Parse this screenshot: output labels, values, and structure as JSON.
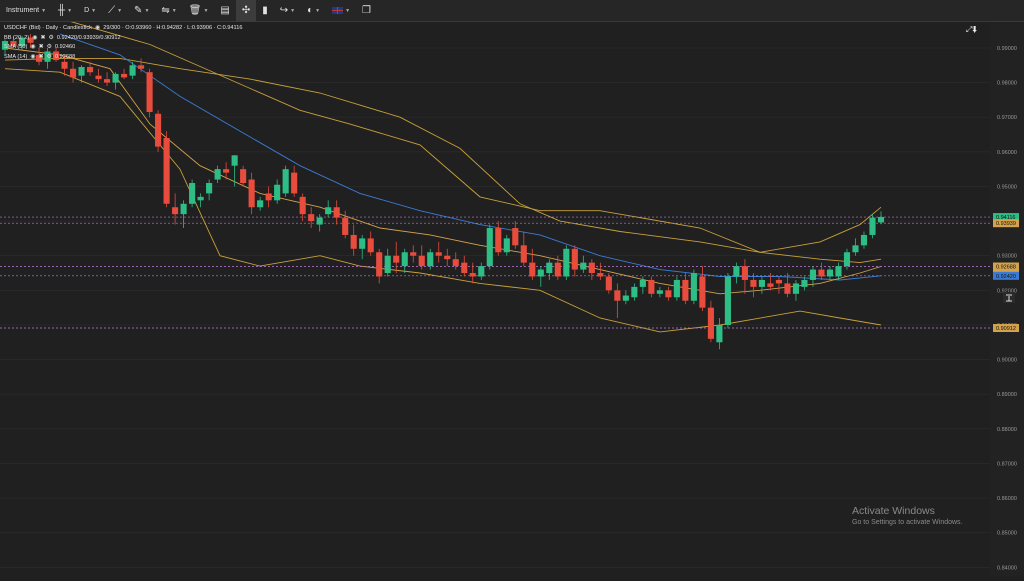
{
  "toolbar": {
    "instrument_label": "Instrument",
    "timeframe_label": "D",
    "icons": [
      "candle-type-icon",
      "line-tool-icon",
      "pen-tool-icon",
      "indicator-tool-icon",
      "trash-icon",
      "layout-icon",
      "crosshair-icon",
      "bar-icon",
      "share-icon",
      "theme-icon",
      "language-flag-icon",
      "new-window-icon"
    ]
  },
  "legend": {
    "main": "USDCHF (Bid) · Daily · Candlestick",
    "ohlc": "29/300 · O:0.93960 · H:0.94282 · L:0.93906 · C:0.94116",
    "indicators": [
      {
        "name": "BB (20, 2)",
        "value": "0.92420/0.93939/0.90912"
      },
      {
        "name": "SMA (50)",
        "value": "0.92460"
      },
      {
        "name": "SMA (14)",
        "value": "0.92688"
      }
    ]
  },
  "watermark": {
    "title": "Activate Windows",
    "subtitle": "Go to Settings to activate Windows."
  },
  "colors": {
    "up": "#2ebd85",
    "down": "#e74c3c",
    "bb": "#c9a03a",
    "sma50": "#3b7bd4",
    "sma14": "#d4a24c",
    "grid": "#2c2c2c",
    "marker": "#c07ae0"
  },
  "chart_data": {
    "type": "candlestick",
    "title": "USDCHF (Bid) · Daily · Candlestick",
    "y_axis_ticks": [
      "0.99000",
      "0.98000",
      "0.97000",
      "0.96000",
      "0.95000",
      "0.94000",
      "0.93000",
      "0.92000",
      "0.91000",
      "0.90000",
      "0.89000",
      "0.88000",
      "0.87000",
      "0.86000",
      "0.85000",
      "0.84000"
    ],
    "ylim": [
      0.8375,
      0.9975
    ],
    "price_tags": [
      {
        "label": "0.94116",
        "value": 0.94116,
        "color": "#2ebd85"
      },
      {
        "label": "0.93939",
        "value": 0.93939,
        "color": "#d4a24c"
      },
      {
        "label": "0.92688",
        "value": 0.92688,
        "color": "#d4a24c"
      },
      {
        "label": "0.92460",
        "value": 0.9246,
        "color": "#d4a24c"
      },
      {
        "label": "0.92420",
        "value": 0.9242,
        "color": "#3b7bd4"
      },
      {
        "label": "0.90912",
        "value": 0.90912,
        "color": "#d4a24c"
      }
    ],
    "candles": [
      [
        0.9895,
        0.9925,
        0.988,
        0.992
      ],
      [
        0.992,
        0.9935,
        0.99,
        0.9905
      ],
      [
        0.9905,
        0.9935,
        0.9895,
        0.993
      ],
      [
        0.993,
        0.994,
        0.99,
        0.9915
      ],
      [
        0.988,
        0.99,
        0.985,
        0.986
      ],
      [
        0.986,
        0.99,
        0.984,
        0.989
      ],
      [
        0.989,
        0.99,
        0.986,
        0.9865
      ],
      [
        0.986,
        0.988,
        0.982,
        0.984
      ],
      [
        0.984,
        0.986,
        0.98,
        0.9815
      ],
      [
        0.982,
        0.985,
        0.98,
        0.9845
      ],
      [
        0.9845,
        0.986,
        0.982,
        0.983
      ],
      [
        0.982,
        0.984,
        0.98,
        0.981
      ],
      [
        0.981,
        0.983,
        0.979,
        0.98
      ],
      [
        0.98,
        0.983,
        0.978,
        0.9825
      ],
      [
        0.9825,
        0.984,
        0.981,
        0.9815
      ],
      [
        0.982,
        0.986,
        0.981,
        0.985
      ],
      [
        0.985,
        0.987,
        0.983,
        0.984
      ],
      [
        0.983,
        0.984,
        0.97,
        0.9715
      ],
      [
        0.971,
        0.972,
        0.96,
        0.9615
      ],
      [
        0.964,
        0.966,
        0.944,
        0.945
      ],
      [
        0.944,
        0.948,
        0.939,
        0.942
      ],
      [
        0.942,
        0.946,
        0.938,
        0.945
      ],
      [
        0.945,
        0.952,
        0.944,
        0.951
      ],
      [
        0.946,
        0.948,
        0.944,
        0.947
      ],
      [
        0.948,
        0.952,
        0.946,
        0.951
      ],
      [
        0.952,
        0.956,
        0.951,
        0.955
      ],
      [
        0.955,
        0.957,
        0.952,
        0.954
      ],
      [
        0.956,
        0.959,
        0.95,
        0.959
      ],
      [
        0.955,
        0.956,
        0.95,
        0.951
      ],
      [
        0.952,
        0.954,
        0.942,
        0.944
      ],
      [
        0.944,
        0.947,
        0.943,
        0.946
      ],
      [
        0.948,
        0.95,
        0.944,
        0.946
      ],
      [
        0.946,
        0.952,
        0.945,
        0.9505
      ],
      [
        0.948,
        0.956,
        0.947,
        0.955
      ],
      [
        0.954,
        0.956,
        0.947,
        0.948
      ],
      [
        0.947,
        0.948,
        0.94,
        0.942
      ],
      [
        0.942,
        0.944,
        0.938,
        0.94
      ],
      [
        0.939,
        0.942,
        0.937,
        0.941
      ],
      [
        0.942,
        0.946,
        0.941,
        0.944
      ],
      [
        0.944,
        0.946,
        0.939,
        0.941
      ],
      [
        0.941,
        0.943,
        0.935,
        0.936
      ],
      [
        0.936,
        0.939,
        0.93,
        0.932
      ],
      [
        0.932,
        0.936,
        0.929,
        0.935
      ],
      [
        0.935,
        0.937,
        0.93,
        0.931
      ],
      [
        0.931,
        0.932,
        0.922,
        0.924
      ],
      [
        0.925,
        0.932,
        0.924,
        0.93
      ],
      [
        0.93,
        0.934,
        0.925,
        0.928
      ],
      [
        0.927,
        0.932,
        0.925,
        0.931
      ],
      [
        0.931,
        0.933,
        0.928,
        0.93
      ],
      [
        0.93,
        0.933,
        0.926,
        0.927
      ],
      [
        0.927,
        0.932,
        0.926,
        0.931
      ],
      [
        0.931,
        0.934,
        0.928,
        0.93
      ],
      [
        0.93,
        0.932,
        0.927,
        0.929
      ],
      [
        0.929,
        0.931,
        0.926,
        0.927
      ],
      [
        0.928,
        0.93,
        0.924,
        0.925
      ],
      [
        0.925,
        0.928,
        0.922,
        0.924
      ],
      [
        0.924,
        0.928,
        0.923,
        0.927
      ],
      [
        0.927,
        0.939,
        0.926,
        0.938
      ],
      [
        0.938,
        0.94,
        0.93,
        0.931
      ],
      [
        0.931,
        0.936,
        0.93,
        0.935
      ],
      [
        0.938,
        0.94,
        0.932,
        0.933
      ],
      [
        0.933,
        0.937,
        0.927,
        0.928
      ],
      [
        0.928,
        0.932,
        0.923,
        0.924
      ],
      [
        0.924,
        0.927,
        0.921,
        0.926
      ],
      [
        0.925,
        0.929,
        0.923,
        0.928
      ],
      [
        0.928,
        0.93,
        0.923,
        0.924
      ],
      [
        0.924,
        0.933,
        0.923,
        0.932
      ],
      [
        0.932,
        0.933,
        0.924,
        0.926
      ],
      [
        0.926,
        0.93,
        0.925,
        0.928
      ],
      [
        0.928,
        0.929,
        0.923,
        0.925
      ],
      [
        0.925,
        0.928,
        0.923,
        0.924
      ],
      [
        0.924,
        0.925,
        0.919,
        0.92
      ],
      [
        0.92,
        0.922,
        0.912,
        0.917
      ],
      [
        0.917,
        0.92,
        0.916,
        0.9185
      ],
      [
        0.918,
        0.922,
        0.917,
        0.921
      ],
      [
        0.921,
        0.924,
        0.919,
        0.923
      ],
      [
        0.923,
        0.924,
        0.918,
        0.919
      ],
      [
        0.919,
        0.921,
        0.918,
        0.92
      ],
      [
        0.92,
        0.921,
        0.917,
        0.918
      ],
      [
        0.918,
        0.924,
        0.917,
        0.923
      ],
      [
        0.923,
        0.925,
        0.916,
        0.917
      ],
      [
        0.917,
        0.926,
        0.916,
        0.925
      ],
      [
        0.924,
        0.927,
        0.914,
        0.915
      ],
      [
        0.915,
        0.917,
        0.905,
        0.906
      ],
      [
        0.905,
        0.912,
        0.903,
        0.91
      ],
      [
        0.91,
        0.925,
        0.909,
        0.924
      ],
      [
        0.924,
        0.928,
        0.922,
        0.927
      ],
      [
        0.927,
        0.929,
        0.919,
        0.923
      ],
      [
        0.923,
        0.925,
        0.918,
        0.921
      ],
      [
        0.921,
        0.924,
        0.919,
        0.923
      ],
      [
        0.922,
        0.925,
        0.92,
        0.921
      ],
      [
        0.923,
        0.924,
        0.919,
        0.922
      ],
      [
        0.922,
        0.925,
        0.918,
        0.919
      ],
      [
        0.919,
        0.923,
        0.917,
        0.922
      ],
      [
        0.921,
        0.924,
        0.92,
        0.923
      ],
      [
        0.923,
        0.927,
        0.921,
        0.926
      ],
      [
        0.926,
        0.928,
        0.923,
        0.924
      ],
      [
        0.924,
        0.927,
        0.923,
        0.926
      ],
      [
        0.924,
        0.928,
        0.923,
        0.927
      ],
      [
        0.927,
        0.932,
        0.926,
        0.931
      ],
      [
        0.931,
        0.935,
        0.93,
        0.933
      ],
      [
        0.933,
        0.937,
        0.932,
        0.936
      ],
      [
        0.936,
        0.942,
        0.935,
        0.941
      ],
      [
        0.9396,
        0.9428,
        0.9391,
        0.9412
      ]
    ],
    "candle_x_range": [
      5,
      881
    ],
    "overlays": [
      {
        "name": "BB (20, 2) upper",
        "color": "#c9a03a",
        "points": [
          [
            5,
            0.9985
          ],
          [
            60,
            0.9985
          ],
          [
            150,
            0.991
          ],
          [
            300,
            0.972
          ],
          [
            350,
            0.968
          ],
          [
            420,
            0.962
          ],
          [
            480,
            0.947
          ],
          [
            540,
            0.943
          ],
          [
            600,
            0.943
          ],
          [
            700,
            0.938
          ],
          [
            760,
            0.931
          ],
          [
            820,
            0.934
          ],
          [
            860,
            0.939
          ],
          [
            881,
            0.944
          ]
        ]
      },
      {
        "name": "BB (20, 2) mid",
        "color": "#c9a03a",
        "points": [
          [
            5,
            0.9865
          ],
          [
            60,
            0.987
          ],
          [
            120,
            0.987
          ],
          [
            180,
            0.984
          ],
          [
            250,
            0.981
          ],
          [
            320,
            0.977
          ],
          [
            400,
            0.97
          ],
          [
            460,
            0.961
          ],
          [
            520,
            0.945
          ],
          [
            560,
            0.94
          ],
          [
            620,
            0.937
          ],
          [
            700,
            0.934
          ],
          [
            760,
            0.931
          ],
          [
            820,
            0.929
          ],
          [
            860,
            0.928
          ],
          [
            881,
            0.929
          ]
        ]
      },
      {
        "name": "BB (20, 2) lower",
        "color": "#c9a03a",
        "points": [
          [
            5,
            0.984
          ],
          [
            60,
            0.983
          ],
          [
            120,
            0.976
          ],
          [
            180,
            0.955
          ],
          [
            220,
            0.93
          ],
          [
            260,
            0.927
          ],
          [
            320,
            0.93
          ],
          [
            360,
            0.927
          ],
          [
            420,
            0.925
          ],
          [
            480,
            0.922
          ],
          [
            540,
            0.92
          ],
          [
            600,
            0.912
          ],
          [
            660,
            0.908
          ],
          [
            720,
            0.91
          ],
          [
            800,
            0.914
          ],
          [
            840,
            0.912
          ],
          [
            881,
            0.91
          ]
        ]
      },
      {
        "name": "SMA (50)",
        "color": "#3b7bd4",
        "points": [
          [
            60,
            0.994
          ],
          [
            120,
            0.988
          ],
          [
            180,
            0.976
          ],
          [
            240,
            0.966
          ],
          [
            300,
            0.956
          ],
          [
            360,
            0.948
          ],
          [
            420,
            0.943
          ],
          [
            480,
            0.939
          ],
          [
            540,
            0.936
          ],
          [
            600,
            0.93
          ],
          [
            660,
            0.926
          ],
          [
            720,
            0.924
          ],
          [
            780,
            0.924
          ],
          [
            840,
            0.923
          ],
          [
            881,
            0.9242
          ]
        ]
      },
      {
        "name": "SMA (14)",
        "color": "#d4a24c",
        "points": [
          [
            5,
            0.99
          ],
          [
            60,
            0.988
          ],
          [
            110,
            0.984
          ],
          [
            150,
            0.968
          ],
          [
            200,
            0.956
          ],
          [
            260,
            0.948
          ],
          [
            320,
            0.944
          ],
          [
            380,
            0.938
          ],
          [
            430,
            0.936
          ],
          [
            480,
            0.933
          ],
          [
            540,
            0.93
          ],
          [
            600,
            0.926
          ],
          [
            660,
            0.922
          ],
          [
            720,
            0.919
          ],
          [
            760,
            0.92
          ],
          [
            820,
            0.922
          ],
          [
            860,
            0.925
          ],
          [
            881,
            0.9269
          ]
        ]
      }
    ],
    "dashed_levels": [
      0.94116,
      0.93939,
      0.92688,
      0.9242,
      0.90912
    ],
    "grid": true
  }
}
